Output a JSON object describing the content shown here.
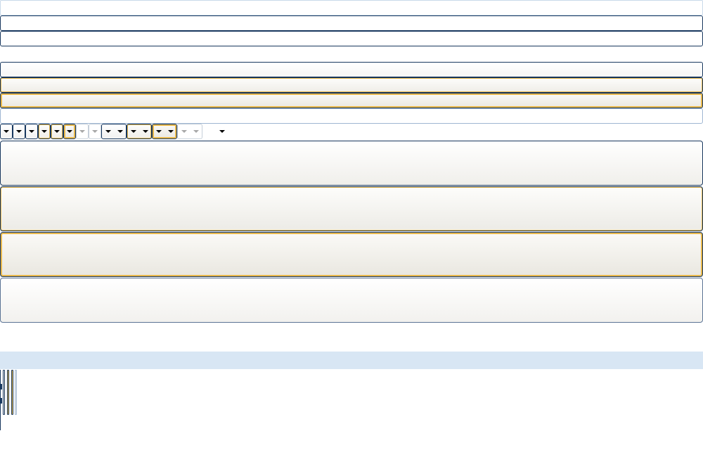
{
  "window": {
    "title": ""
  },
  "bars": {
    "top": "",
    "row1": "",
    "row2": "",
    "row3": "",
    "row4": "",
    "row5": "",
    "row6": ""
  },
  "dropdowns": {
    "icon": "chevron-down-icon",
    "count": 15
  },
  "big_buttons": [
    "",
    "",
    "",
    ""
  ],
  "colors": {
    "border": "#17375e",
    "hover_accent": "#e8b84c",
    "band": "#d8e6f4",
    "disabled_border": "#9eb6d2"
  }
}
